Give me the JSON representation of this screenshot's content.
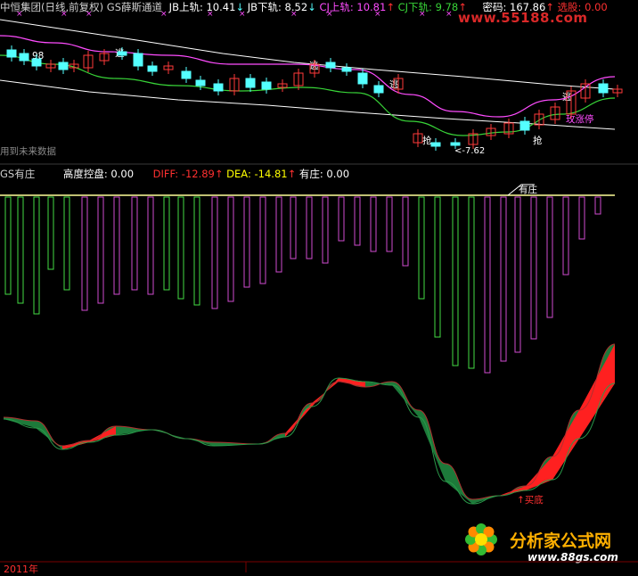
{
  "header": {
    "stock_name": "中恒集团",
    "mode": "(日线,前复权)",
    "indicator_name": "GS薛斯通道",
    "jb_upper_label": "JB上轨:",
    "jb_upper_value": "10.41",
    "jb_lower_label": "JB下轨:",
    "jb_lower_value": "8.52",
    "cj_upper_label": "CJ上轨:",
    "cj_upper_value": "10.81",
    "cj_lower_label": "CJ下轨:",
    "cj_lower_value": "9.78",
    "code_label": "密码:",
    "code_value": "167.86",
    "select_label": "选股:",
    "select_value": "0.00",
    "watermark_url": "www.55188.com"
  },
  "main_chart": {
    "price_tag": "98",
    "escape_label": "逃",
    "grab_label": "抢",
    "limit_up_label": "玫涨停",
    "future_data_note": "用到未来数据",
    "low_price_tag": "<-7.62"
  },
  "sub_header": {
    "indicator_name": "GS有庄",
    "control_label": "高度控盘:",
    "control_value": "0.00",
    "diff_label": "DIFF:",
    "diff_value": "-12.89",
    "dea_label": "DEA:",
    "dea_value": "-14.81",
    "zhuang_label": "有庄:",
    "zhuang_value": "0.00",
    "zhuang_marker": "有庄"
  },
  "bottom_chart": {
    "buy_bottom_label": "↑买底"
  },
  "footer": {
    "year_label": "2011年",
    "logo_text": "分析家公式网",
    "logo_url": "www.88gs.com"
  },
  "colors": {
    "background": "#000000",
    "up_candle": "#ff3a3a",
    "down_candle": "#54ffff",
    "channel_white": "#ffffff",
    "channel_magenta": "#ff4cff",
    "channel_green": "#38d438",
    "histogram_green": "#44dd44",
    "histogram_magenta": "#d04bd0",
    "ribbon_red": "#ff2020",
    "ribbon_green": "#1d7a3a",
    "label_yellow": "#ffff00",
    "label_white": "#ffffff",
    "label_red": "#ff3030"
  }
}
